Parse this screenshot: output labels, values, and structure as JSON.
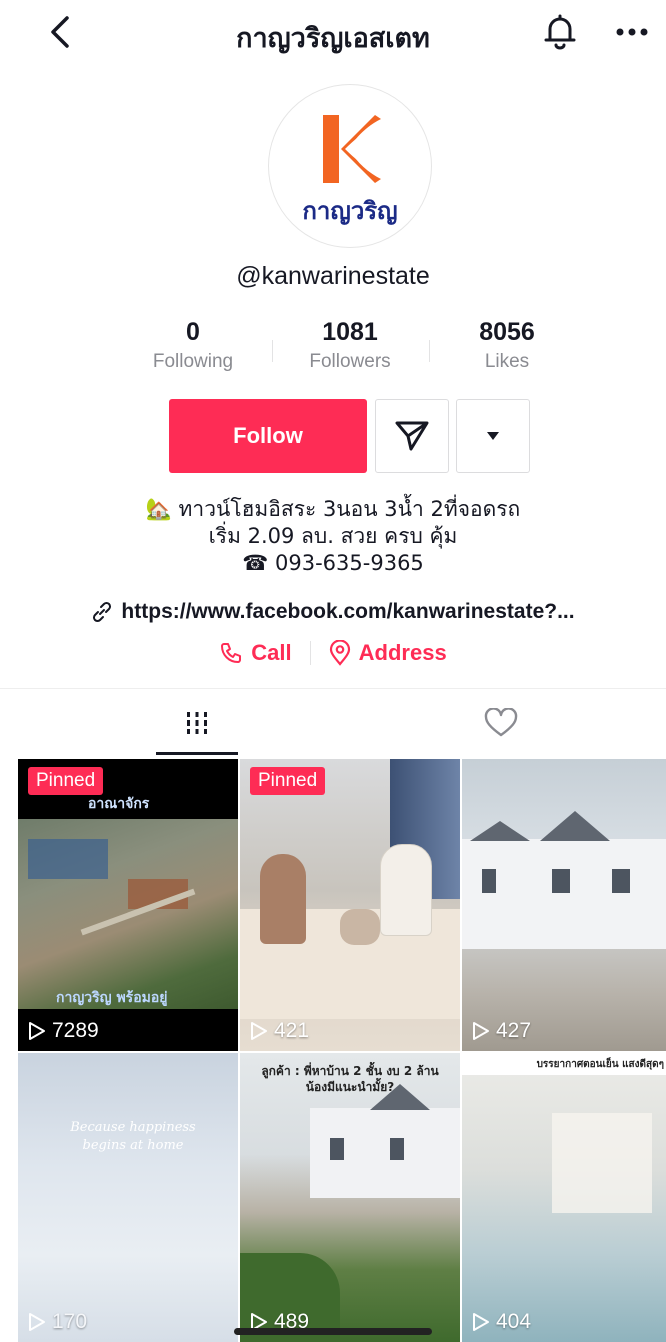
{
  "header": {
    "title": "กาญวริญเอสเตท"
  },
  "profile": {
    "logo_text": "กาญวริญ",
    "username": "@kanwarinestate",
    "stats": [
      {
        "value": "0",
        "label": "Following"
      },
      {
        "value": "1081",
        "label": "Followers"
      },
      {
        "value": "8056",
        "label": "Likes"
      }
    ],
    "follow_label": "Follow",
    "bio_lines": [
      "🏡 ทาวน์โฮมอิสระ 3นอน 3น้ำ 2ที่จอดรถ",
      "เริ่ม 2.09 ลบ. สวย ครบ คุ้ม",
      "☎ 093-635-9365"
    ],
    "link": "https://www.facebook.com/kanwarinestate?...",
    "call_label": "Call",
    "address_label": "Address"
  },
  "videos": [
    {
      "pinned": "Pinned",
      "views": "7289",
      "top_text": "อาณาจักร",
      "bottom_text": "กาญวริญ พร้อมอยู่"
    },
    {
      "pinned": "Pinned",
      "views": "421"
    },
    {
      "views": "427"
    },
    {
      "views": "170",
      "script_text": "Because happiness begins at home"
    },
    {
      "views": "489",
      "top_text": "ลูกค้า : พี่หาบ้าน 2 ชั้น งบ 2 ล้าน น้องมีแนะนำมั้ย?"
    },
    {
      "views": "404",
      "top_text": "บรรยากาศตอนเย็น แสงดีสุดๆ"
    }
  ]
}
